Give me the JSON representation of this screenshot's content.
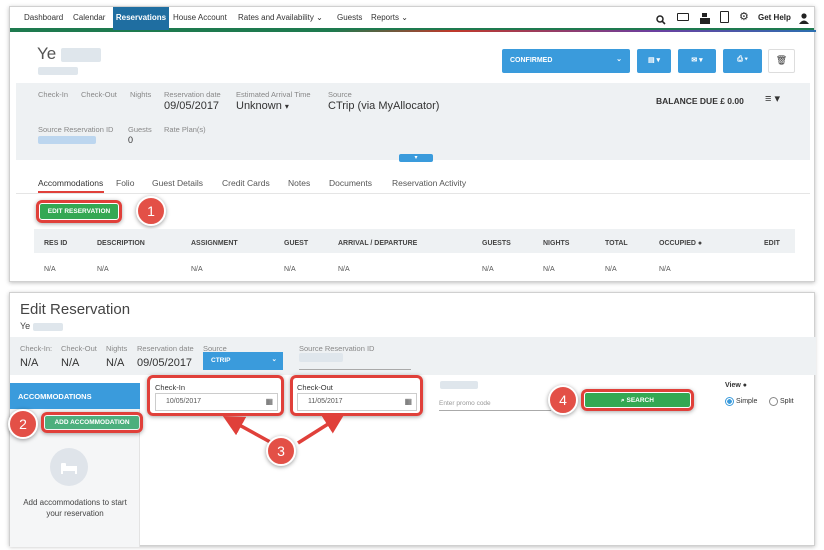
{
  "nav": {
    "items": [
      "Dashboard",
      "Calendar",
      "Reservations",
      "House Account",
      "Rates and Availability",
      "Guests",
      "Reports"
    ],
    "active": "Reservations",
    "get_help": "Get Help"
  },
  "reservation": {
    "guest_name": "Ye",
    "labels": {
      "checkin": "Check-In",
      "checkout": "Check-Out",
      "nights": "Nights",
      "res_date": "Reservation date",
      "eta": "Estimated Arrival Time",
      "source": "Source",
      "source_res_id": "Source Reservation ID",
      "guests": "Guests",
      "rate_plans": "Rate Plan(s)"
    },
    "res_date": "09/05/2017",
    "eta": "Unknown",
    "source": "CTrip (via MyAllocator)",
    "guests": "0",
    "status": "CONFIRMED",
    "balance": "BALANCE DUE £ 0.00"
  },
  "tabs": [
    "Accommodations",
    "Folio",
    "Guest Details",
    "Credit Cards",
    "Notes",
    "Documents",
    "Reservation Activity"
  ],
  "edit_reservation_button": "EDIT RESERVATION",
  "table": {
    "headers": [
      "RES ID",
      "DESCRIPTION",
      "ASSIGNMENT",
      "GUEST",
      "ARRIVAL / DEPARTURE",
      "GUESTS",
      "NIGHTS",
      "TOTAL",
      "OCCUPIED",
      "EDIT"
    ],
    "row": [
      "N/A",
      "N/A",
      "N/A",
      "N/A",
      "N/A",
      "N/A",
      "N/A",
      "N/A",
      "N/A"
    ]
  },
  "edit_panel": {
    "title": "Edit Reservation",
    "guest_name": "Ye",
    "labels": {
      "checkin": "Check-In:",
      "checkout": "Check-Out",
      "nights": "Nights",
      "res_date": "Reservation date",
      "source": "Source",
      "source_res_id": "Source Reservation ID"
    },
    "checkin": "N/A",
    "checkout": "N/A",
    "nights": "N/A",
    "res_date": "09/05/2017",
    "source": "CTRIP",
    "accommodations_header": "ACCOMMODATIONS",
    "add_accommodation": "ADD ACCOMMODATION",
    "empty_text": "Add accommodations to start your reservation",
    "checkin_label": "Check-In",
    "checkin_value": "10/05/2017",
    "checkout_label": "Check-Out",
    "checkout_value": "11/05/2017",
    "promo_placeholder": "Enter promo code",
    "search_button": "SEARCH",
    "view_label": "View",
    "view_simple": "Simple",
    "view_split": "Split"
  },
  "callouts": [
    "1",
    "2",
    "3",
    "4"
  ],
  "colors": {
    "accent": "#3a9bdc",
    "green": "#34a853",
    "callout": "#e35047",
    "nav_active": "#1f6ea1"
  }
}
